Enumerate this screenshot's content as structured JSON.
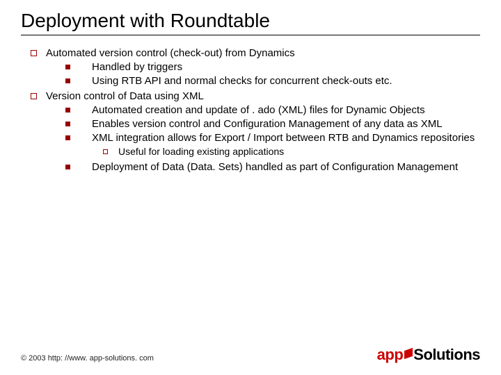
{
  "title": "Deployment with Roundtable",
  "bullets": {
    "b1": "Automated version control (check-out) from Dynamics",
    "b1_1": "Handled by triggers",
    "b1_2": "Using RTB API and normal checks for concurrent check-outs etc.",
    "b2": "Version control of Data using XML",
    "b2_1": "Automated creation and update of . ado (XML) files for Dynamic Objects",
    "b2_2": "Enables version control and Configuration Management of any data as XML",
    "b2_3": "XML integration allows for Export / Import between RTB and Dynamics repositories",
    "b2_3_1": "Useful for loading existing applications",
    "b2_4": "Deployment of Data (Data. Sets) handled as part of Configuration Management"
  },
  "footer": {
    "copyright": "© 2003 http: //www. app-solutions. com",
    "logo_left": "app",
    "logo_right": "Solutions"
  }
}
